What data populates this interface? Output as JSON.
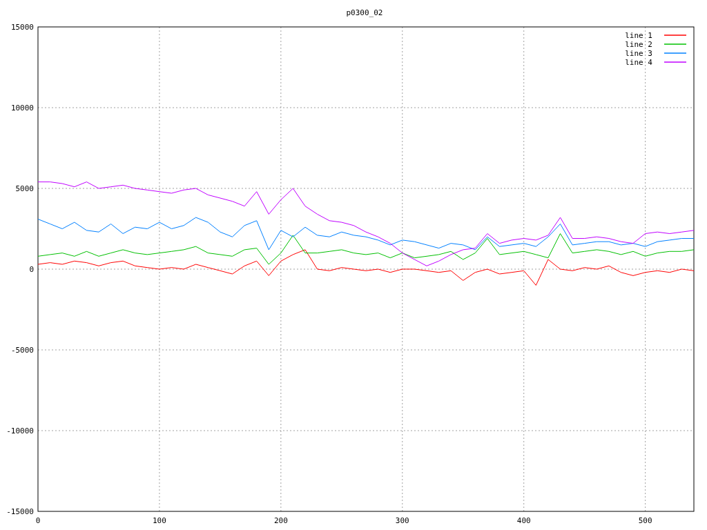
{
  "chart": {
    "chart_data": {
      "type": "line",
      "title": "p0300_02",
      "x": [
        0,
        10,
        20,
        30,
        40,
        50,
        60,
        70,
        80,
        90,
        100,
        110,
        120,
        130,
        140,
        150,
        160,
        170,
        180,
        190,
        200,
        210,
        220,
        230,
        240,
        250,
        260,
        270,
        280,
        290,
        300,
        310,
        320,
        330,
        340,
        350,
        360,
        370,
        380,
        390,
        400,
        410,
        420,
        430,
        440,
        450,
        460,
        470,
        480,
        490,
        500,
        510,
        520,
        530,
        540
      ],
      "xlim": [
        0,
        540
      ],
      "ylim": [
        -15000,
        15000
      ],
      "xticks": [
        0,
        100,
        200,
        300,
        400,
        500
      ],
      "yticks": [
        -15000,
        -10000,
        -5000,
        0,
        5000,
        10000,
        15000
      ],
      "grid": true,
      "legend": true,
      "series": [
        {
          "name": "line 1",
          "color": "#ff0000",
          "values": [
            300,
            400,
            300,
            500,
            400,
            200,
            400,
            500,
            200,
            100,
            0,
            100,
            0,
            300,
            100,
            -100,
            -300,
            200,
            500,
            -400,
            500,
            900,
            1200,
            0,
            -100,
            100,
            0,
            -100,
            0,
            -200,
            0,
            0,
            -100,
            -200,
            -100,
            -700,
            -200,
            0,
            -300,
            -200,
            -100,
            -1000,
            600,
            0,
            -100,
            100,
            0,
            200,
            -200,
            -400,
            -200,
            -100,
            -200,
            0,
            -100
          ]
        },
        {
          "name": "line 2",
          "color": "#00c000",
          "values": [
            800,
            900,
            1000,
            800,
            1100,
            800,
            1000,
            1200,
            1000,
            900,
            1000,
            1100,
            1200,
            1400,
            1000,
            900,
            800,
            1200,
            1300,
            300,
            1000,
            2100,
            1000,
            1000,
            1100,
            1200,
            1000,
            900,
            1000,
            700,
            1000,
            700,
            800,
            900,
            1100,
            600,
            1000,
            1900,
            900,
            1000,
            1100,
            900,
            700,
            2200,
            1000,
            1100,
            1200,
            1100,
            900,
            1100,
            800,
            1000,
            1100,
            1100,
            1200
          ]
        },
        {
          "name": "line 3",
          "color": "#0080ff",
          "values": [
            3100,
            2800,
            2500,
            2900,
            2400,
            2300,
            2800,
            2200,
            2600,
            2500,
            2900,
            2500,
            2700,
            3200,
            2900,
            2300,
            2000,
            2700,
            3000,
            1200,
            2400,
            2000,
            2600,
            2100,
            2000,
            2300,
            2100,
            2000,
            1800,
            1500,
            1800,
            1700,
            1500,
            1300,
            1600,
            1500,
            1200,
            2000,
            1400,
            1500,
            1600,
            1400,
            2000,
            2800,
            1500,
            1600,
            1700,
            1700,
            1500,
            1600,
            1400,
            1700,
            1800,
            1900,
            1900
          ]
        },
        {
          "name": "line 4",
          "color": "#c000ff",
          "values": [
            5400,
            5400,
            5300,
            5100,
            5400,
            5000,
            5100,
            5200,
            5000,
            4900,
            4800,
            4700,
            4900,
            5000,
            4600,
            4400,
            4200,
            3900,
            4800,
            3400,
            4300,
            5000,
            3900,
            3400,
            3000,
            2900,
            2700,
            2300,
            2000,
            1600,
            1000,
            600,
            200,
            500,
            900,
            1200,
            1300,
            2200,
            1600,
            1800,
            1900,
            1800,
            2100,
            3200,
            1900,
            1900,
            2000,
            1900,
            1700,
            1600,
            2200,
            2300,
            2200,
            2300,
            2400
          ]
        }
      ]
    }
  }
}
